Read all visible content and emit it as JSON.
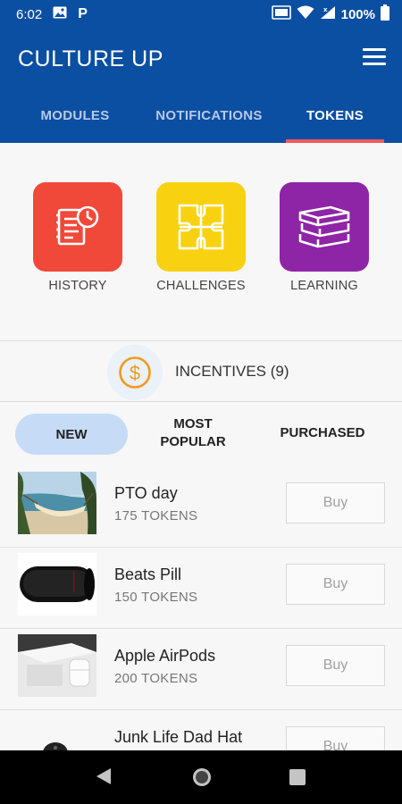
{
  "status_bar": {
    "time": "6:02",
    "battery": "100%"
  },
  "app": {
    "title": "CULTURE UP"
  },
  "tabs": [
    {
      "label": "MODULES"
    },
    {
      "label": "NOTIFICATIONS"
    },
    {
      "label": "TOKENS"
    }
  ],
  "quick_links": [
    {
      "label": "HISTORY",
      "color": "#f0493a"
    },
    {
      "label": "CHALLENGES",
      "color": "#f8d211"
    },
    {
      "label": "LEARNING",
      "color": "#8e25a6"
    }
  ],
  "incentives": {
    "label": "INCENTIVES (9)",
    "accent": "#f29a1f"
  },
  "filters": {
    "new": "NEW",
    "most_popular_line1": "MOST",
    "most_popular_line2": "POPULAR",
    "purchased": "PURCHASED"
  },
  "products": [
    {
      "name": "PTO day",
      "price": "175 TOKENS",
      "buy": "Buy",
      "image_icon": "hammock-beach-photo"
    },
    {
      "name": "Beats Pill",
      "price": "150 TOKENS",
      "buy": "Buy",
      "image_icon": "speaker-photo"
    },
    {
      "name": "Apple AirPods",
      "price": "200 TOKENS",
      "buy": "Buy",
      "image_icon": "airpods-photo"
    },
    {
      "name": "Junk Life Dad Hat",
      "price": "",
      "buy": "Buy",
      "image_icon": "hat-photo"
    }
  ],
  "colors": {
    "brand": "#0b4fa2",
    "tab_indicator": "#f25a5a",
    "pill": "#c6dbf5"
  }
}
